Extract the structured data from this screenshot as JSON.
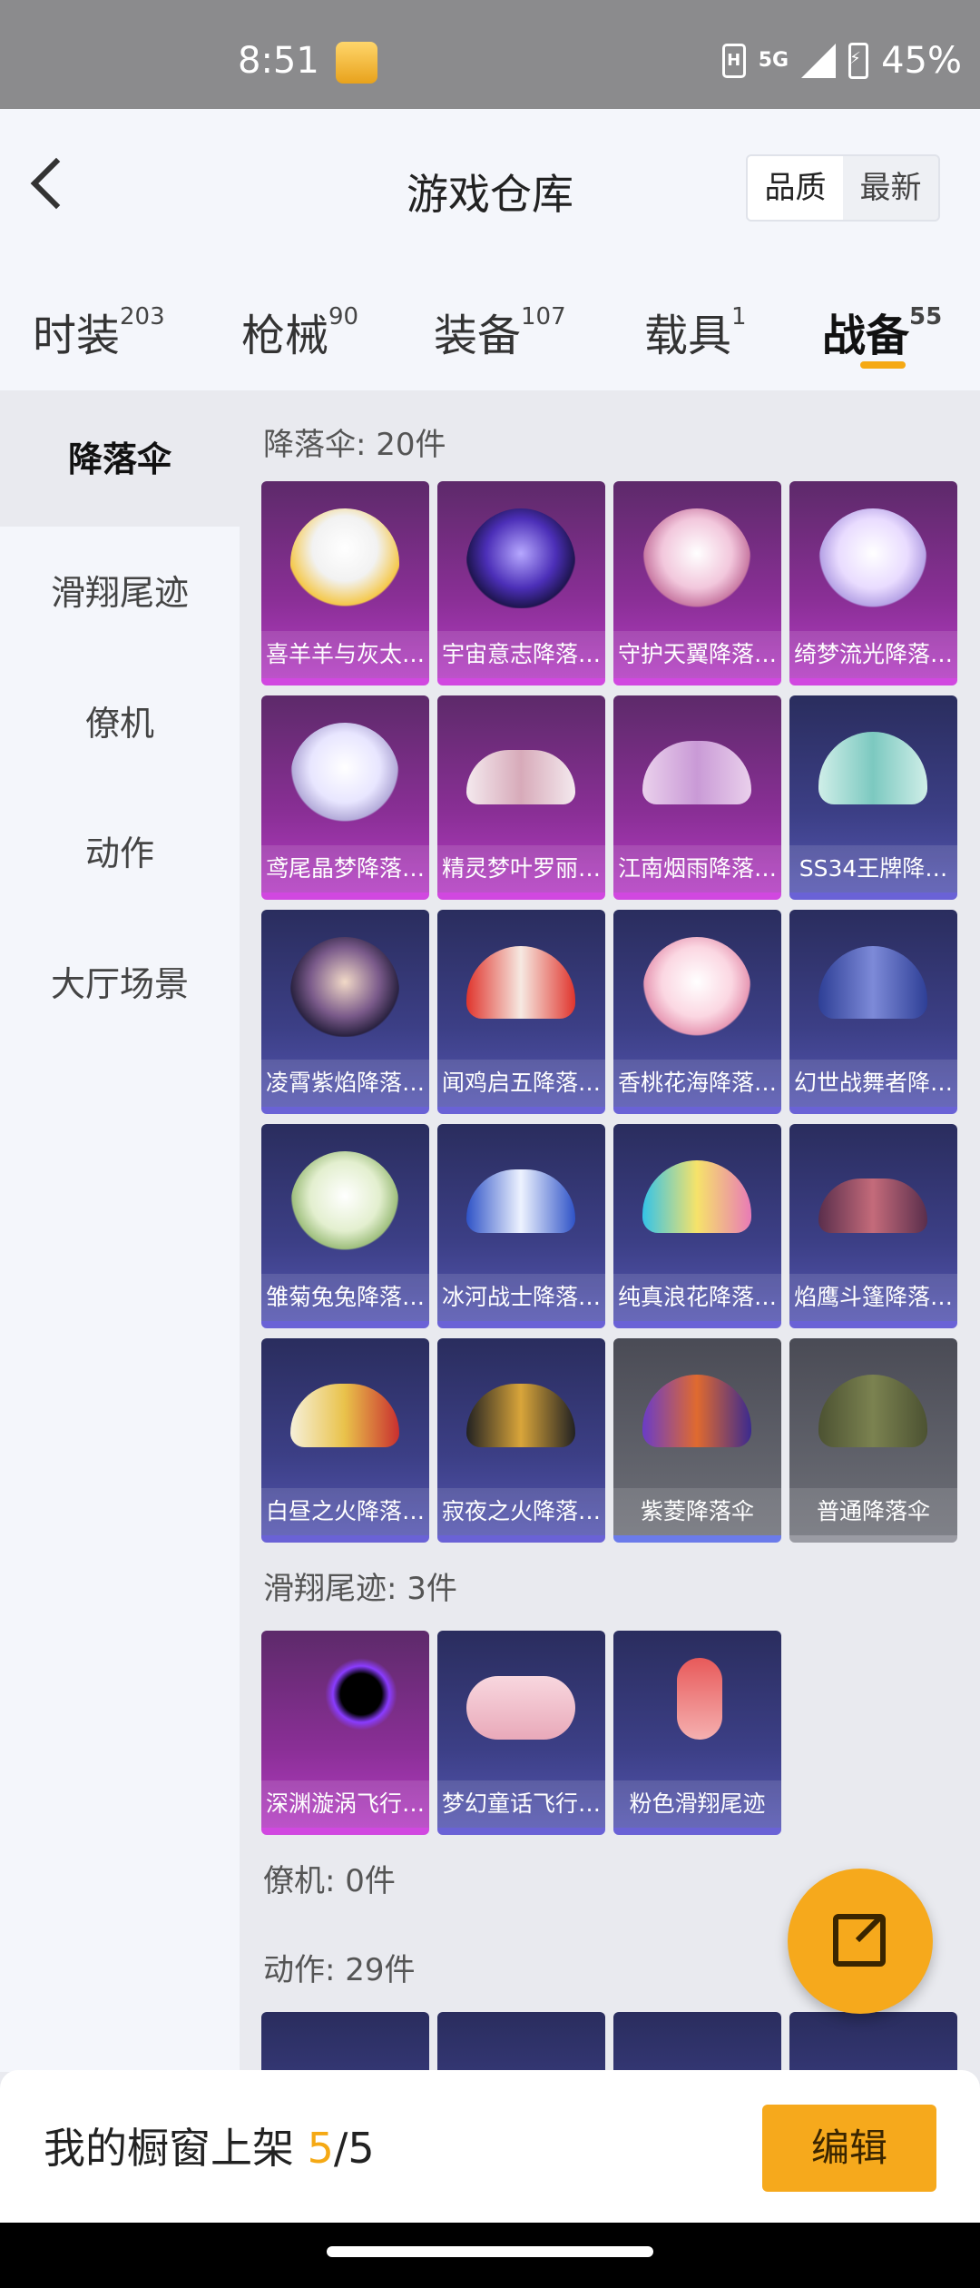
{
  "status_bar": {
    "time": "8:51",
    "network": "5G",
    "battery": "45%"
  },
  "header": {
    "title": "游戏仓库",
    "sort_options": [
      "品质",
      "最新"
    ],
    "active_sort": "品质"
  },
  "tabs": [
    {
      "label": "时装",
      "count": "203"
    },
    {
      "label": "枪械",
      "count": "90"
    },
    {
      "label": "装备",
      "count": "107"
    },
    {
      "label": "载具",
      "count": "1"
    },
    {
      "label": "战备",
      "count": "55",
      "active": true
    }
  ],
  "sidebar": {
    "items": [
      {
        "label": "降落伞",
        "active": true
      },
      {
        "label": "滑翔尾迹"
      },
      {
        "label": "僚机"
      },
      {
        "label": "动作"
      },
      {
        "label": "大厅场景"
      }
    ]
  },
  "sections": {
    "parachutes": {
      "title": "降落伞: 20件",
      "items": [
        "喜羊羊与灰太…",
        "宇宙意志降落…",
        "守护天翼降落…",
        "绮梦流光降落…",
        "鸢尾晶梦降落…",
        "精灵梦叶罗丽…",
        "江南烟雨降落…",
        "SS34王牌降…",
        "凌霄紫焰降落…",
        "闻鸡启五降落…",
        "香桃花海降落…",
        "幻世战舞者降…",
        "雏菊兔兔降落…",
        "冰河战士降落…",
        "纯真浪花降落…",
        "焰鹰斗篷降落…",
        "白昼之火降落…",
        "寂夜之火降落…",
        "紫菱降落伞",
        "普通降落伞"
      ]
    },
    "trails": {
      "title": "滑翔尾迹: 3件",
      "items": [
        "深渊漩涡飞行…",
        "梦幻童话飞行…",
        "粉色滑翔尾迹"
      ]
    },
    "wingman": {
      "title": "僚机: 0件"
    },
    "actions": {
      "title": "动作: 29件"
    }
  },
  "bottom_bar": {
    "label": "我的橱窗上架",
    "count_current": "5",
    "count_total": "/5",
    "edit_label": "编辑"
  },
  "colors": {
    "accent": "#f6a91c",
    "rarity_pink": "#b33cc2",
    "rarity_blue": "#5455b0",
    "rarity_gray": "#6e7078"
  }
}
